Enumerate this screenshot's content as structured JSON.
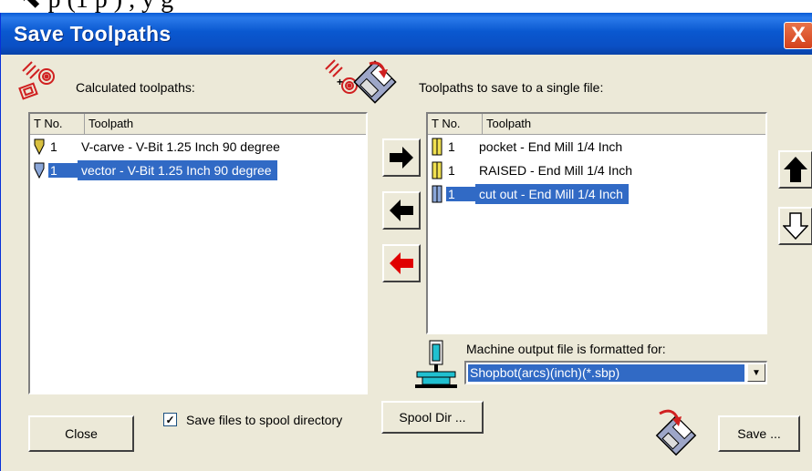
{
  "background_text": "⬉ p   (1 p      ) , y g",
  "window": {
    "title": "Save Toolpaths",
    "close_label": "X"
  },
  "left": {
    "label": "Calculated toolpaths:",
    "columns": [
      "T No.",
      "Toolpath"
    ],
    "rows": [
      {
        "tno": "1",
        "name": "V-carve - V-Bit 1.25 Inch 90 degree",
        "selected": false,
        "icon": "v-bit-icon"
      },
      {
        "tno": "1",
        "name": "vector - V-Bit 1.25 Inch 90 degree",
        "selected": true,
        "icon": "v-bit-icon"
      }
    ]
  },
  "right": {
    "label": "Toolpaths to save to a single file:",
    "columns": [
      "T No.",
      "Toolpath"
    ],
    "rows": [
      {
        "tno": "1",
        "name": "pocket - End Mill 1/4 Inch",
        "selected": false,
        "icon": "end-mill-icon"
      },
      {
        "tno": "1",
        "name": "RAISED - End Mill 1/4 Inch",
        "selected": false,
        "icon": "end-mill-icon"
      },
      {
        "tno": "1",
        "name": "cut out - End Mill 1/4 Inch",
        "selected": true,
        "icon": "end-mill-icon"
      }
    ]
  },
  "machine": {
    "label": "Machine output file is formatted for:",
    "selected": "Shopbot(arcs)(inch)(*.sbp)"
  },
  "footer": {
    "close_label": "Close",
    "spool_checkbox_label": "Save files to spool directory",
    "spool_checked": true,
    "spool_dir_label": "Spool Dir ...",
    "save_label": "Save ..."
  },
  "colors": {
    "selection": "#316ac5",
    "title_bar": "#0a4fc4",
    "dialog_bg": "#ece9d8",
    "red_arrow": "#e00000"
  }
}
